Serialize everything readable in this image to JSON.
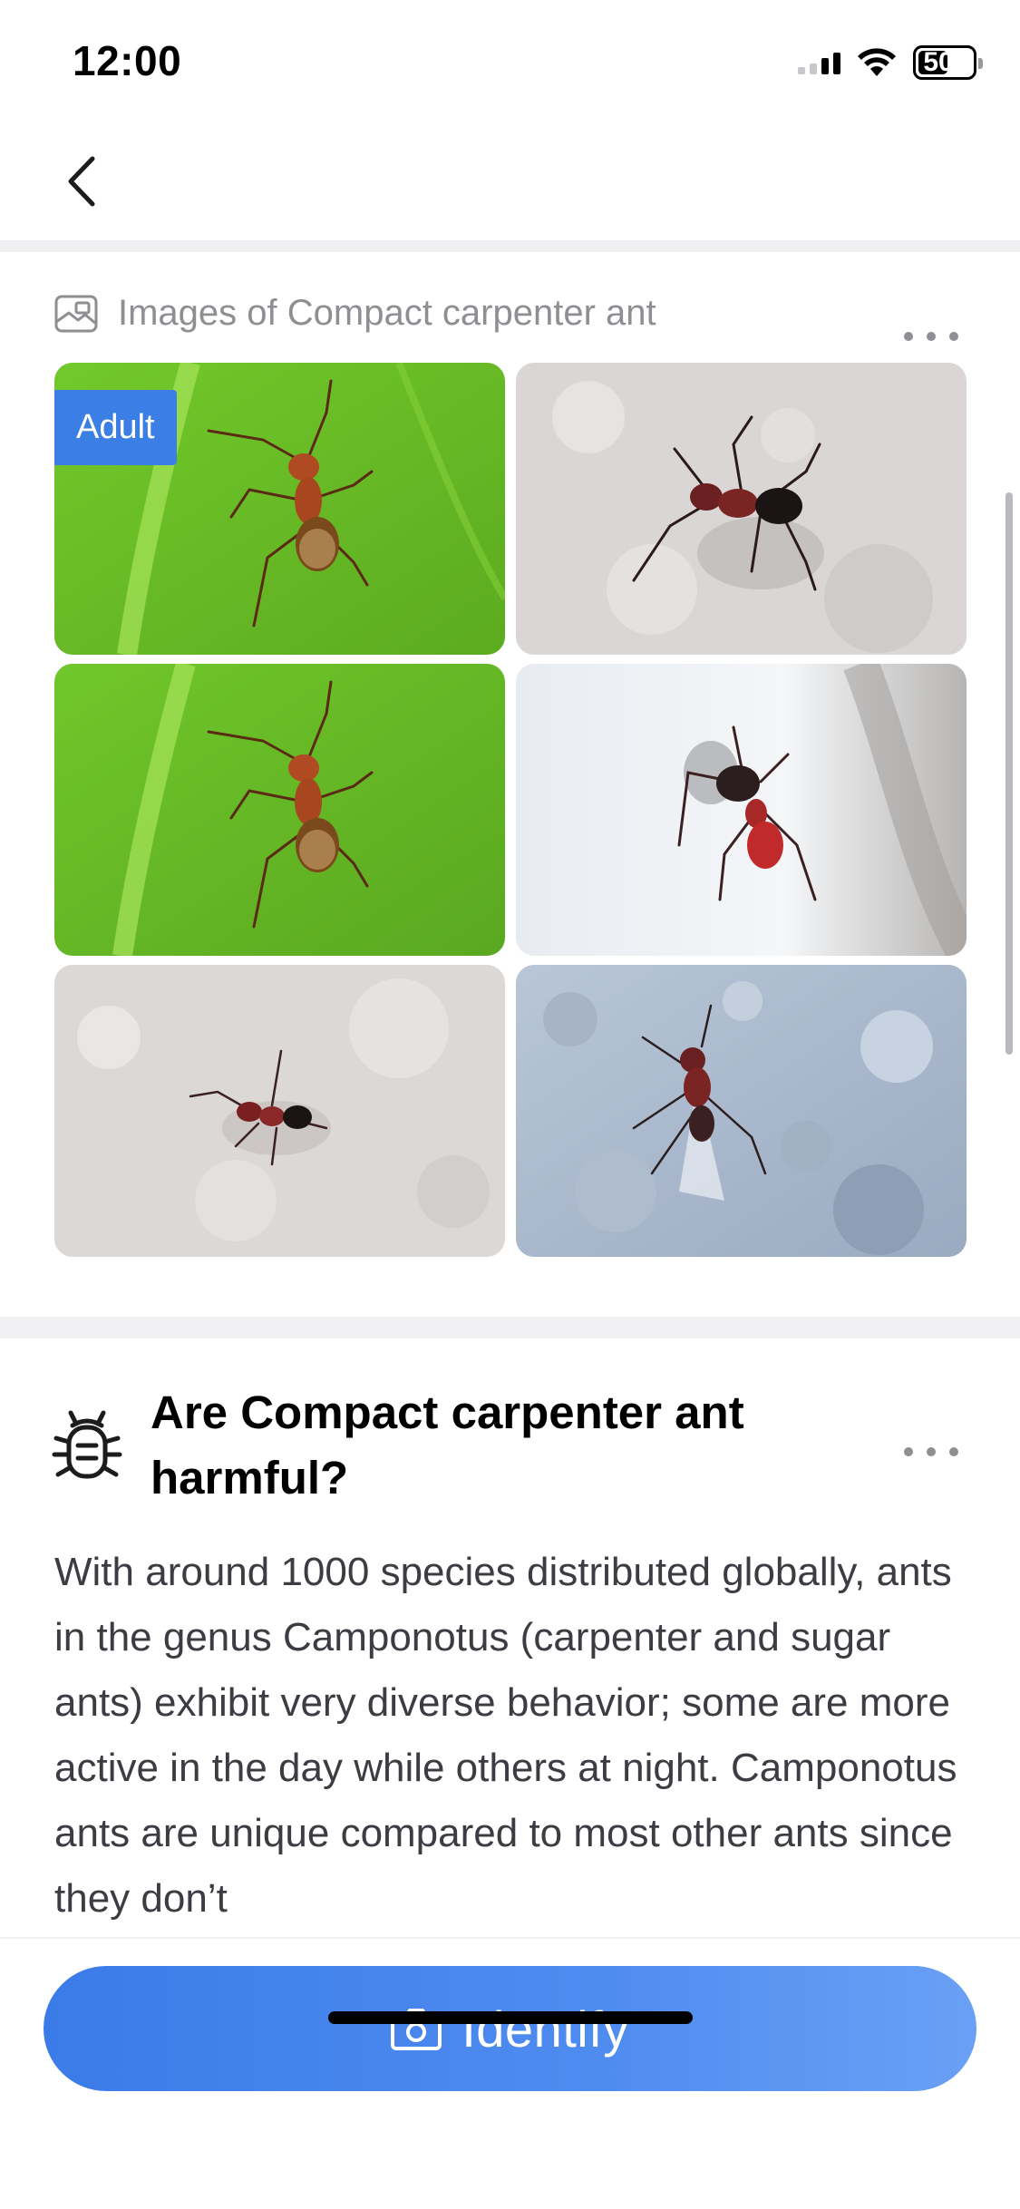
{
  "status_bar": {
    "time": "12:00",
    "battery_level": "50",
    "signal_bars_active": 2
  },
  "nav": {
    "back_icon": "chevron-left-icon"
  },
  "images_section": {
    "icon": "image-gallery-icon",
    "title": "Images of Compact carpenter ant",
    "images": [
      {
        "subject": "red ant on green leaf",
        "badge": "Adult"
      },
      {
        "subject": "dark ant on white textured wall",
        "badge": ""
      },
      {
        "subject": "red ant on green leaf",
        "badge": ""
      },
      {
        "subject": "red and black ant on white surface",
        "badge": ""
      },
      {
        "subject": "small ant on white wall",
        "badge": ""
      },
      {
        "subject": "winged ant on blue-grey wall",
        "badge": ""
      }
    ]
  },
  "harm_section": {
    "icon": "bug-icon",
    "title": "Are Compact carpenter ant harmful?",
    "body": "With around 1000 species distributed globally, ants in the genus Camponotus (carpenter and sugar ants) exhibit very diverse behavior; some are more active in the day while others at night. Camponotus ants are unique compared to most other ants since they don’t"
  },
  "bottom": {
    "identify_label": "Identify",
    "identify_icon": "camera-icon"
  },
  "colors": {
    "accent": "#3a7ee6",
    "secondary_text": "#8e8e93"
  }
}
